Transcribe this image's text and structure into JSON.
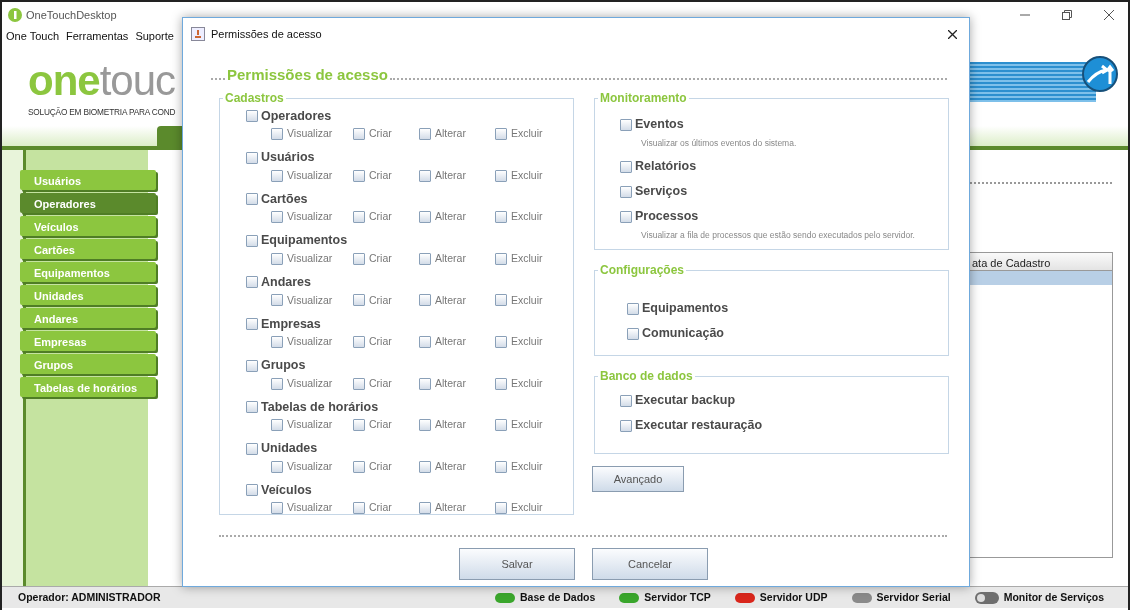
{
  "app": {
    "title": "OneTouchDesktop",
    "menu": [
      "One Touch",
      "Ferramentas",
      "Suporte"
    ],
    "logo": {
      "part_1": "one",
      "part_2": "touc"
    },
    "tagline": "SOLUÇÃO EM BIOMETRIA PARA COND",
    "sidebar": [
      {
        "label": "Usuários",
        "selected": false
      },
      {
        "label": "Operadores",
        "selected": true
      },
      {
        "label": "Veículos",
        "selected": false
      },
      {
        "label": "Cartões",
        "selected": false
      },
      {
        "label": "Equipamentos",
        "selected": false
      },
      {
        "label": "Unidades",
        "selected": false
      },
      {
        "label": "Andares",
        "selected": false
      },
      {
        "label": "Empresas",
        "selected": false
      },
      {
        "label": "Grupos",
        "selected": false
      },
      {
        "label": "Tabelas de horários",
        "selected": false
      }
    ],
    "table": {
      "columns": [
        "ata de Cadastro"
      ],
      "rows": [
        {
          "selected": true
        }
      ]
    },
    "operator": "Operador: ADMINISTRADOR",
    "status_bar": [
      {
        "label": "Base de Dados",
        "kind": "status",
        "color": "#3aa62c"
      },
      {
        "label": "Servidor TCP",
        "kind": "status",
        "color": "#3aa62c"
      },
      {
        "label": "Servidor UDP",
        "kind": "status",
        "color": "#d9261c"
      },
      {
        "label": "Servidor Serial",
        "kind": "status",
        "color": "#8a8a8a"
      },
      {
        "label": "Monitor de Serviços",
        "kind": "toggle",
        "color": "#6e6e6e"
      }
    ]
  },
  "dialog": {
    "title": "Permissões de acesso",
    "heading": "Permissões de acesso",
    "cadastros": {
      "title": "Cadastros",
      "items": [
        {
          "label": "Operadores",
          "checked": false,
          "permissions": [
            {
              "label": "Visualizar",
              "checked": false
            },
            {
              "label": "Criar",
              "checked": false
            },
            {
              "label": "Alterar",
              "checked": false
            },
            {
              "label": "Excluir",
              "checked": false
            }
          ]
        },
        {
          "label": "Usuários",
          "checked": false,
          "permissions": [
            {
              "label": "Visualizar",
              "checked": false
            },
            {
              "label": "Criar",
              "checked": false
            },
            {
              "label": "Alterar",
              "checked": false
            },
            {
              "label": "Excluir",
              "checked": false
            }
          ]
        },
        {
          "label": "Cartões",
          "checked": false,
          "permissions": [
            {
              "label": "Visualizar",
              "checked": false
            },
            {
              "label": "Criar",
              "checked": false
            },
            {
              "label": "Alterar",
              "checked": false
            },
            {
              "label": "Excluir",
              "checked": false
            }
          ]
        },
        {
          "label": "Equipamentos",
          "checked": false,
          "permissions": [
            {
              "label": "Visualizar",
              "checked": false
            },
            {
              "label": "Criar",
              "checked": false
            },
            {
              "label": "Alterar",
              "checked": false
            },
            {
              "label": "Excluir",
              "checked": false
            }
          ]
        },
        {
          "label": "Andares",
          "checked": false,
          "permissions": [
            {
              "label": "Visualizar",
              "checked": false
            },
            {
              "label": "Criar",
              "checked": false
            },
            {
              "label": "Alterar",
              "checked": false
            },
            {
              "label": "Excluir",
              "checked": false
            }
          ]
        },
        {
          "label": "Empresas",
          "checked": false,
          "permissions": [
            {
              "label": "Visualizar",
              "checked": false
            },
            {
              "label": "Criar",
              "checked": false
            },
            {
              "label": "Alterar",
              "checked": false
            },
            {
              "label": "Excluir",
              "checked": false
            }
          ]
        },
        {
          "label": "Grupos",
          "checked": false,
          "permissions": [
            {
              "label": "Visualizar",
              "checked": false
            },
            {
              "label": "Criar",
              "checked": false
            },
            {
              "label": "Alterar",
              "checked": false
            },
            {
              "label": "Excluir",
              "checked": false
            }
          ]
        },
        {
          "label": "Tabelas de horários",
          "checked": false,
          "permissions": [
            {
              "label": "Visualizar",
              "checked": false
            },
            {
              "label": "Criar",
              "checked": false
            },
            {
              "label": "Alterar",
              "checked": false
            },
            {
              "label": "Excluir",
              "checked": false
            }
          ]
        },
        {
          "label": "Unidades",
          "checked": false,
          "permissions": [
            {
              "label": "Visualizar",
              "checked": false
            },
            {
              "label": "Criar",
              "checked": false
            },
            {
              "label": "Alterar",
              "checked": false
            },
            {
              "label": "Excluir",
              "checked": false
            }
          ]
        },
        {
          "label": "Veículos",
          "checked": false,
          "permissions": [
            {
              "label": "Visualizar",
              "checked": false
            },
            {
              "label": "Criar",
              "checked": false
            },
            {
              "label": "Alterar",
              "checked": false
            },
            {
              "label": "Excluir",
              "checked": false
            }
          ]
        }
      ]
    },
    "monitoramento": {
      "title": "Monitoramento",
      "items": [
        {
          "label": "Eventos",
          "checked": false,
          "description": "Visualizar os últimos eventos do sistema."
        },
        {
          "label": "Relatórios",
          "checked": false
        },
        {
          "label": "Serviços",
          "checked": false
        },
        {
          "label": "Processos",
          "checked": false,
          "description": "Visualizar a fila de processos que estão sendo executados pelo servidor."
        }
      ]
    },
    "configuracoes": {
      "title": "Configurações",
      "items": [
        {
          "label": "Equipamentos",
          "checked": false
        },
        {
          "label": "Comunicação",
          "checked": false
        }
      ]
    },
    "banco_de_dados": {
      "title": "Banco de dados",
      "items": [
        {
          "label": "Executar backup",
          "checked": false
        },
        {
          "label": "Executar restauração",
          "checked": false
        }
      ]
    },
    "advanced_button": "Avançado",
    "buttons": [
      "Salvar",
      "Cancelar"
    ]
  }
}
